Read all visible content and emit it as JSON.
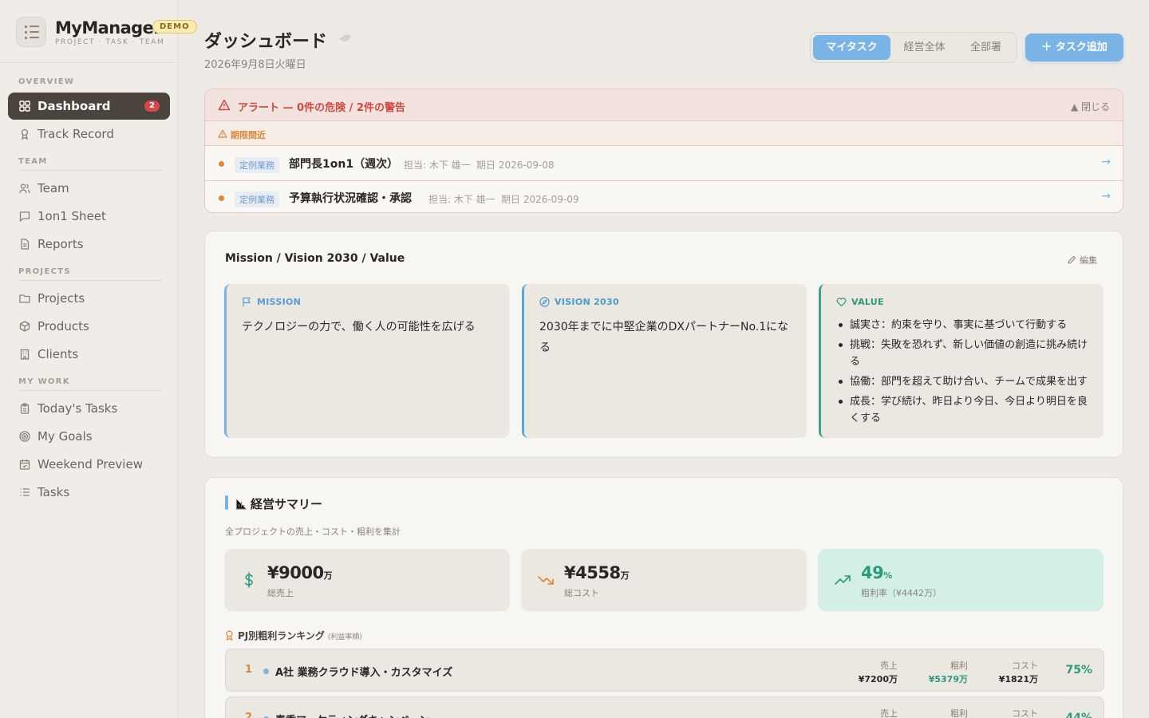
{
  "brand": {
    "name": "MyManager",
    "tagline": "PROJECT · TASK · TEAM",
    "badge": "DEMO"
  },
  "sidebar": {
    "sections": [
      {
        "label": "OVERVIEW"
      },
      {
        "label": "TEAM"
      },
      {
        "label": "PROJECTS"
      },
      {
        "label": "MY WORK"
      }
    ],
    "items": [
      {
        "label": "Dashboard",
        "icon": "grid-icon",
        "badge": "2",
        "active": true
      },
      {
        "label": "Track Record",
        "icon": "award-icon"
      },
      {
        "label": "Team",
        "icon": "users-icon"
      },
      {
        "label": "1on1 Sheet",
        "icon": "chat-icon"
      },
      {
        "label": "Reports",
        "icon": "document-icon"
      },
      {
        "label": "Projects",
        "icon": "folder-icon"
      },
      {
        "label": "Products",
        "icon": "box-icon"
      },
      {
        "label": "Clients",
        "icon": "building-icon"
      },
      {
        "label": "Today's Tasks",
        "icon": "clipboard-icon"
      },
      {
        "label": "My Goals",
        "icon": "target-icon"
      },
      {
        "label": "Weekend Preview",
        "icon": "calendar-icon"
      },
      {
        "label": "Tasks",
        "icon": "list-icon"
      }
    ]
  },
  "header": {
    "title": "ダッシュボード",
    "date": "2026年9月8日火曜日",
    "tabs": [
      {
        "label": "マイタスク",
        "active": true
      },
      {
        "label": "経営全体"
      },
      {
        "label": "全部署"
      }
    ],
    "add_button": "＋ タスク追加"
  },
  "alert": {
    "title": "アラート — 0件の危険 / 2件の警告",
    "close": "▲ 閉じる",
    "group": "期限間近",
    "rows": [
      {
        "tag": "定例業務",
        "title": "部門長1on1（週次）",
        "assignee": "担当: 木下 雄一",
        "due": "期日 2026-09-08"
      },
      {
        "tag": "定例業務",
        "title": "予算執行状況確認・承認",
        "assignee": "担当: 木下 雄一",
        "due": "期日 2026-09-09"
      }
    ]
  },
  "mvv": {
    "title": "Mission / Vision 2030 / Value",
    "edit": "編集",
    "mission": {
      "label": "MISSION",
      "text": "テクノロジーの力で、働く人の可能性を広げる"
    },
    "vision": {
      "label": "VISION 2030",
      "text": "2030年までに中堅企業のDXパートナーNo.1になる"
    },
    "value": {
      "label": "VALUE",
      "items": [
        "誠実さ：約束を守り、事実に基づいて行動する",
        "挑戦：失敗を恐れず、新しい価値の創造に挑み続ける",
        "協働：部門を超えて助け合い、チームで成果を出す",
        "成長：学び続け、昨日より今日、今日より明日を良くする"
      ]
    }
  },
  "summary": {
    "title": "経営サマリー",
    "subtitle": "全プロジェクトの売上・コスト・粗利を集計",
    "kpis": [
      {
        "value": "¥9000",
        "unit": "万",
        "label": "総売上"
      },
      {
        "value": "¥4558",
        "unit": "万",
        "label": "総コスト"
      },
      {
        "value": "49",
        "unit": "%",
        "label": "粗利率（¥4442万）"
      }
    ],
    "ranking_title": "PJ別粗利ランキング",
    "ranking_note": "(利益率順)",
    "ranking": [
      {
        "rank": "1",
        "name": "A社 業務クラウド導入・カスタマイズ",
        "sales_label": "売上",
        "sales": "¥7200万",
        "profit_label": "粗利",
        "profit": "¥5379万",
        "cost_label": "コスト",
        "cost": "¥1821万",
        "pct": "75%"
      },
      {
        "rank": "2",
        "name": "春季マーケティングキャンペーン",
        "sales_label": "売上",
        "sales": "",
        "profit_label": "粗利",
        "profit": "",
        "cost_label": "コスト",
        "cost": "",
        "pct": "44%"
      }
    ]
  },
  "colors": {
    "accent": "#7ab3e6",
    "danger": "#d0483f",
    "warning": "#d8893c",
    "success": "#2a9a7c",
    "sidebar_active": "#4a443d"
  }
}
